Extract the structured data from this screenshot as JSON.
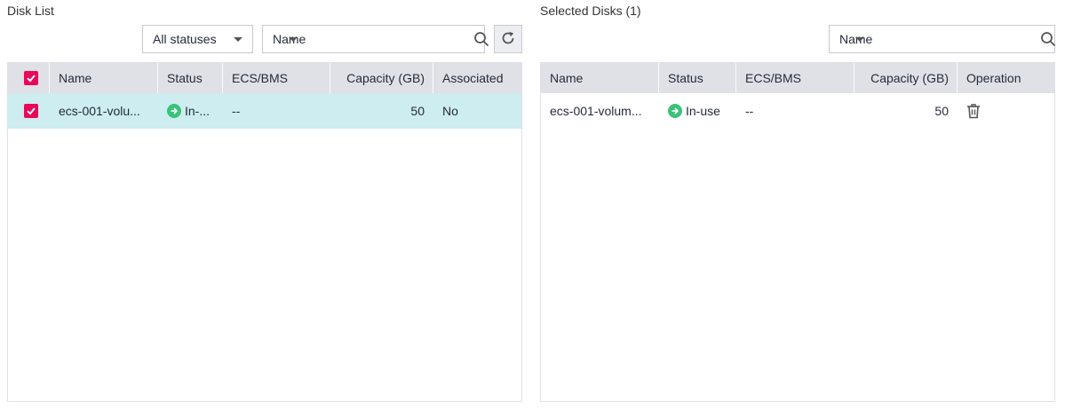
{
  "left_panel": {
    "title": "Disk List",
    "status_filter": "All statuses",
    "search_field": "Name",
    "search_placeholder": "",
    "columns": [
      "Name",
      "Status",
      "ECS/BMS",
      "Capacity (GB)",
      "Associated"
    ],
    "rows": [
      {
        "selected": true,
        "name": "ecs-001-volu...",
        "status": "In-...",
        "ecs_bms": "--",
        "capacity": "50",
        "associated": "No"
      }
    ]
  },
  "right_panel": {
    "title": "Selected Disks (1)",
    "search_field": "Name",
    "search_placeholder": "",
    "columns": [
      "Name",
      "Status",
      "ECS/BMS",
      "Capacity (GB)",
      "Operation"
    ],
    "rows": [
      {
        "name": "ecs-001-volum...",
        "status": "In-use",
        "ecs_bms": "--",
        "capacity": "50"
      }
    ]
  },
  "icons": {
    "search": "search-icon",
    "refresh": "refresh-icon",
    "checkbox": "checkmark-icon",
    "status": "arrow-right-circle-icon",
    "delete": "trash-icon",
    "dropdown": "caret-down-icon"
  },
  "colors": {
    "accent": "#e8085b",
    "status_ok": "#3bc27a",
    "selected_row": "#cdedf0",
    "header_bg": "#dfe1e6"
  }
}
